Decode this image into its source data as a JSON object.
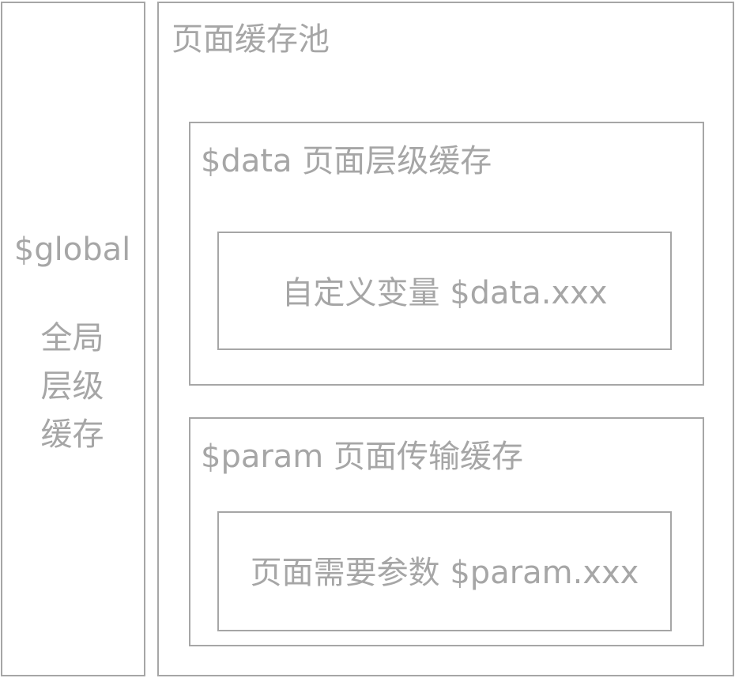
{
  "global": {
    "variable": "$global",
    "description_lines": [
      "全局",
      "层级",
      "缓存"
    ]
  },
  "page_pool": {
    "title": "页面缓存池",
    "data_cache": {
      "title": "$data 页面层级缓存",
      "inner_label": "自定义变量 $data.xxx"
    },
    "param_cache": {
      "title": "$param 页面传输缓存",
      "inner_label": "页面需要参数 $param.xxx"
    }
  },
  "colors": {
    "stroke": "#a6a6a6",
    "text": "#a6a6a6",
    "background": "#ffffff"
  }
}
